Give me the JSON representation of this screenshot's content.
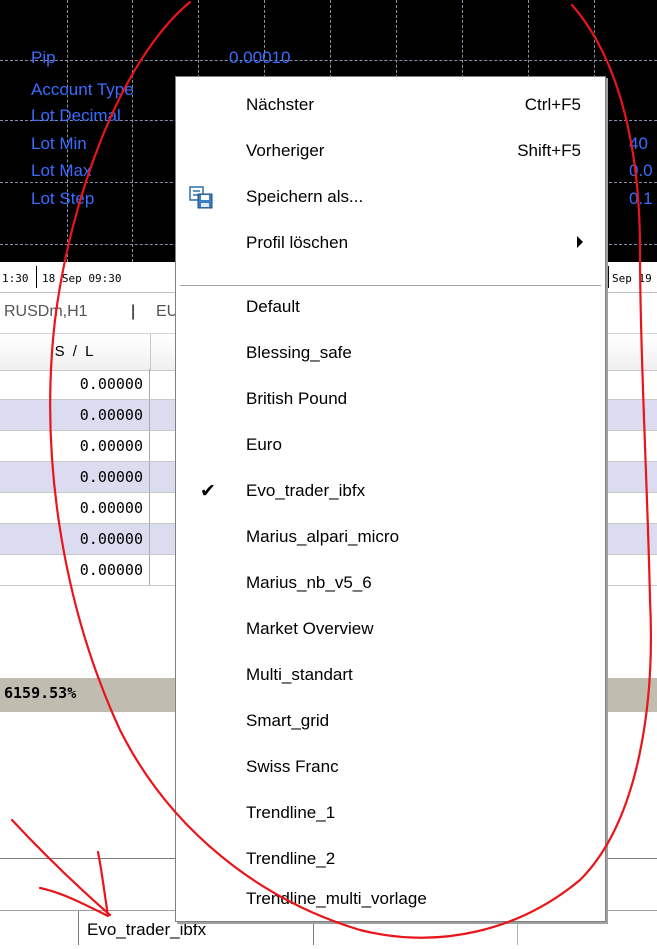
{
  "chart": {
    "labels": [
      "Pip",
      "Account Type",
      "Lot Decimal",
      "Lot Min",
      "Lot Max",
      "Lot Step"
    ],
    "pip_value": "0.00010",
    "right_values": [
      "40",
      "0.0",
      "0.1"
    ],
    "text_color": "#3b6cff",
    "background": "#000000"
  },
  "time_axis": {
    "ticks": [
      "1:30",
      "18 Sep 09:30",
      "Sep 19"
    ]
  },
  "chart_tabs": {
    "items": [
      "RUSDm,H1",
      "EU"
    ],
    "separator": "|"
  },
  "table": {
    "header": "S / L",
    "rows": [
      "0.00000",
      "0.00000",
      "0.00000",
      "0.00000",
      "0.00000",
      "0.00000",
      "0.00000"
    ],
    "total": "6159.53%",
    "alt_row_color": "#dcdcf0",
    "total_row_color": "#c0bdb0"
  },
  "bottom": {
    "active_tab": "Evo_trader_ibfx"
  },
  "menu": {
    "top_items": [
      {
        "label": "Nächster",
        "shortcut": "Ctrl+F5"
      },
      {
        "label": "Vorheriger",
        "shortcut": "Shift+F5"
      },
      {
        "label": "Speichern als...",
        "icon": "save-profile-icon"
      },
      {
        "label": "Profil löschen",
        "submenu": true
      }
    ],
    "profiles": [
      "Default",
      "Blessing_safe",
      "British Pound",
      "Euro",
      "Evo_trader_ibfx",
      "Marius_alpari_micro",
      "Marius_nb_v5_6",
      "Market Overview",
      "Multi_standart",
      "Smart_grid",
      "Swiss Franc",
      "Trendline_1",
      "Trendline_2",
      "Trendline_multi_vorlage"
    ],
    "checked_profile": "Evo_trader_ibfx",
    "check_mark": "✔"
  },
  "annotation": {
    "color": "#e8151b",
    "shapes": [
      "circle-around-menu",
      "arrow-to-active-tab"
    ]
  }
}
